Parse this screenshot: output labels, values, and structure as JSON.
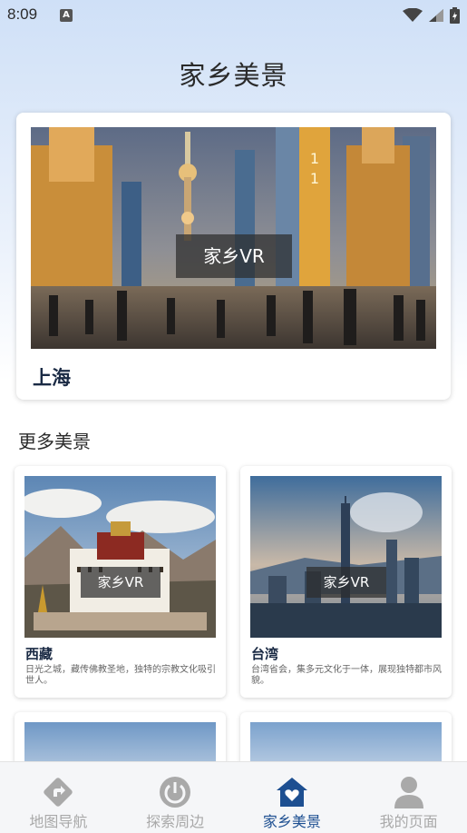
{
  "status_bar": {
    "time": "8:09",
    "notification_letter": "A"
  },
  "header": {
    "title": "家乡美景"
  },
  "hero": {
    "vr_label": "家乡VR",
    "name": "上海"
  },
  "section": {
    "title": "更多美景"
  },
  "cards": [
    {
      "vr_label": "家乡VR",
      "name": "西藏",
      "description": "日光之城，藏传佛教圣地，独特的宗教文化吸引世人。"
    },
    {
      "vr_label": "家乡VR",
      "name": "台湾",
      "description": "台湾省会，集多元文化于一体，展现独特都市风貌。"
    }
  ],
  "nav": [
    {
      "label": "地图导航",
      "icon": "direction-icon",
      "active": false
    },
    {
      "label": "探索周边",
      "icon": "power-icon",
      "active": false
    },
    {
      "label": "家乡美景",
      "icon": "home-heart-icon",
      "active": true
    },
    {
      "label": "我的页面",
      "icon": "person-icon",
      "active": false
    }
  ],
  "colors": {
    "accent": "#1d4f91",
    "inactive": "#a9a9a9"
  }
}
